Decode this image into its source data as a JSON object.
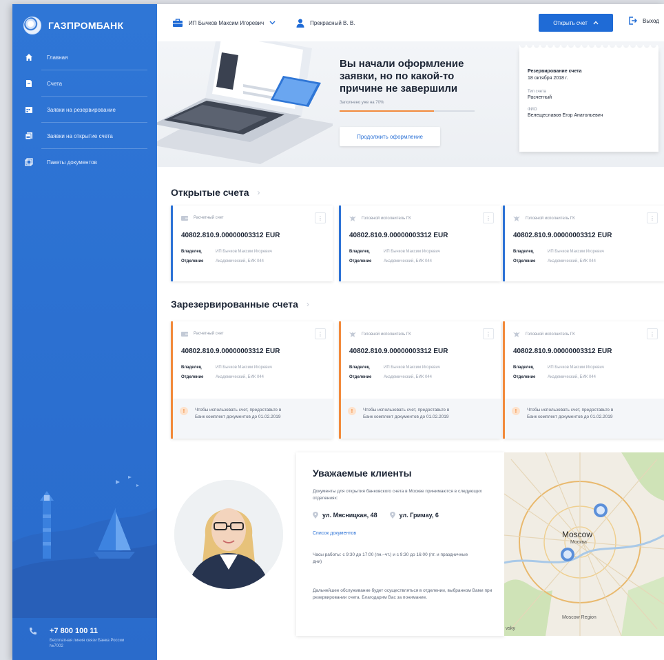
{
  "brand": {
    "name": "ГАЗПРОМБАНК"
  },
  "sidebar": {
    "items": [
      {
        "label": "Главная",
        "icon": "home-icon"
      },
      {
        "label": "Счета",
        "icon": "document-icon"
      },
      {
        "label": "Заявки на резервирование",
        "icon": "calendar-icon"
      },
      {
        "label": "Заявки на открытие счета",
        "icon": "document-list-icon"
      },
      {
        "label": "Пакеты документов",
        "icon": "folder-icon"
      }
    ],
    "phone": "+7 800 100 11",
    "phone_note": "Бесплатная линия связи Банка России №7002"
  },
  "header": {
    "org": "ИП Бычков Максим Игоревич",
    "person": "Прекрасный В. В.",
    "open_account": "Открыть счет",
    "logout": "Выход"
  },
  "banner": {
    "title": "Вы начали оформление заявки, но по какой-то причине не завершили",
    "progress_label": "Заполнено уже на 70%",
    "progress": 0.7,
    "continue": "Продолжить оформление",
    "receipt": {
      "title": "Резервирование счета",
      "date": "18 октября 2018 г.",
      "type_label": "Тип счета",
      "type_value": "Расчетный",
      "who_label": "ФИО",
      "who_value": "Велещеславов Егор Анатольевич"
    }
  },
  "open_accounts": {
    "title": "Открытые счета",
    "cards": [
      {
        "type": "Расчетный счет",
        "icon": "wallet-icon",
        "number": "40802.810.9.00000003312 EUR",
        "owner_label": "Владелец",
        "owner": "ИП Бычков Максим Игоревич",
        "branch_label": "Отделение",
        "branch": "Академический, БИК 044"
      },
      {
        "type": "Головной исполнитель ГК",
        "icon": "eagle-icon",
        "number": "40802.810.9.00000003312 EUR",
        "owner_label": "Владелец",
        "owner": "ИП Бычков Максим Игоревич",
        "branch_label": "Отделение",
        "branch": "Академический, БИК 044"
      },
      {
        "type": "Головной исполнитель ГК",
        "icon": "eagle-icon",
        "number": "40802.810.9.00000003312 EUR",
        "owner_label": "Владелец",
        "owner": "ИП Бычков Максим Игоревич",
        "branch_label": "Отделение",
        "branch": "Академический, БИК 044"
      }
    ]
  },
  "reserved_accounts": {
    "title": "Зарезервированные счета",
    "cards": [
      {
        "type": "Расчетный счет",
        "icon": "wallet-icon",
        "number": "40802.810.9.00000003312 EUR",
        "owner_label": "Владелец",
        "owner": "ИП Бычков Максим Игоревич",
        "branch_label": "Отделение",
        "branch": "Академический, БИК 044",
        "notice": "Чтобы использовать счет, предоставьте в Банк комплект документов до 01.02.2019"
      },
      {
        "type": "Головной исполнитель ГК",
        "icon": "eagle-icon",
        "number": "40802.810.9.00000003312 EUR",
        "owner_label": "Владелец",
        "owner": "ИП Бычков Максим Игоревич",
        "branch_label": "Отделение",
        "branch": "Академический, БИК 044",
        "notice": "Чтобы использовать счет, предоставьте в Банк комплект документов до 01.02.2019"
      },
      {
        "type": "Головной исполнитель ГК",
        "icon": "eagle-icon",
        "number": "40802.810.9.00000003312 EUR",
        "owner_label": "Владелец",
        "owner": "ИП Бычков Максим Игоревич",
        "branch_label": "Отделение",
        "branch": "Академический, БИК 044",
        "notice": "Чтобы использовать счет, предоставьте в Банк комплект документов до 01.02.2019"
      }
    ]
  },
  "clients": {
    "title": "Уважаемые клиенты",
    "intro": "Документы для открытия банковского счета в Москве принимаются в следующих отделениях:",
    "address_1": "ул. Мясницкая, 48",
    "address_2": "ул. Гримау, 6",
    "doc_link": "Список документов",
    "hours": "Часы работы: с 9:30 до 17:00 (пн.–чт.) и с 9:30 до 16:00 (пт. и праздничные дни)",
    "footer": "Дальнейшее обслуживание будет осуществляться в отделении, выбранном Вами при резервировании счета. Благодарим Вас за понимание."
  },
  "map": {
    "city_label": "Moscow",
    "city_sub": "Москва",
    "bottom_label": "Moscow Region",
    "side_label": "vsky"
  },
  "colors": {
    "primary": "#2c72d6",
    "sidebar": "#2f76d6",
    "accent": "#f28a3b"
  }
}
